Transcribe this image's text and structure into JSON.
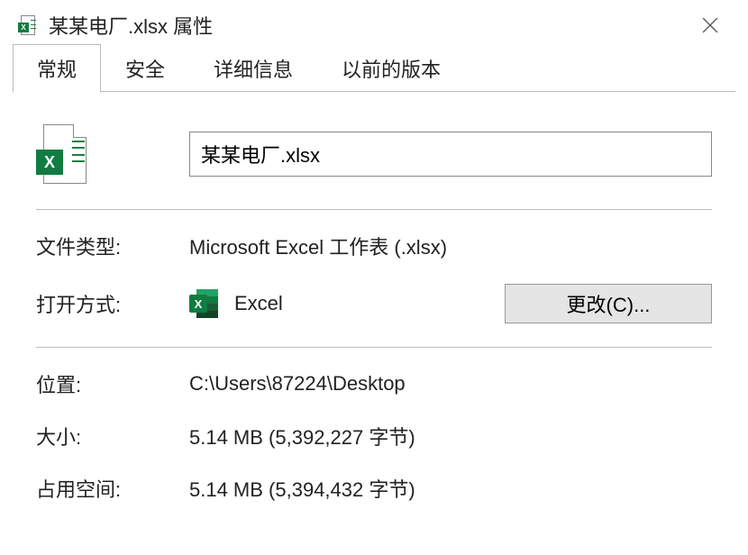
{
  "titlebar": {
    "text": "某某电厂.xlsx 属性"
  },
  "tabs": {
    "general": "常规",
    "security": "安全",
    "details": "详细信息",
    "previous": "以前的版本"
  },
  "filename": "某某电厂.xlsx",
  "labels": {
    "file_type": "文件类型:",
    "open_with": "打开方式:",
    "location": "位置:",
    "size": "大小:",
    "size_on_disk": "占用空间:"
  },
  "values": {
    "file_type": "Microsoft Excel 工作表 (.xlsx)",
    "open_with": "Excel",
    "location": "C:\\Users\\87224\\Desktop",
    "size": "5.14 MB (5,392,227 字节)",
    "size_on_disk": "5.14 MB (5,394,432 字节)"
  },
  "buttons": {
    "change": "更改(C)..."
  }
}
